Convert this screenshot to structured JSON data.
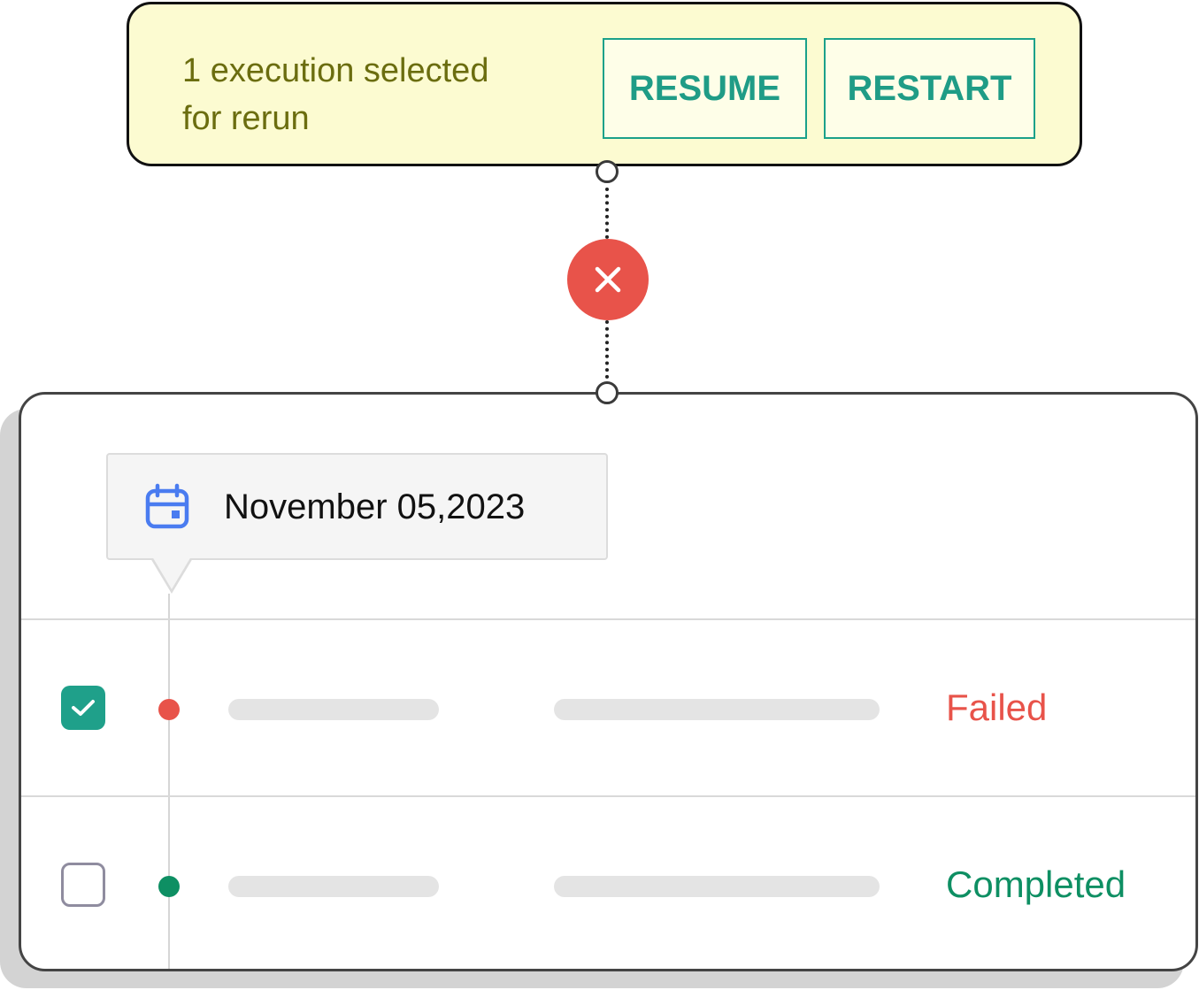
{
  "banner": {
    "selection_text": "1 execution selected\nfor rerun",
    "resume_label": "RESUME",
    "restart_label": "RESTART",
    "background_color": "#fcfbd1",
    "accent_color": "#1f9c86"
  },
  "connector": {
    "status_icon": "close-icon",
    "status_color": "#e8534a"
  },
  "list": {
    "date_icon": "calendar-icon",
    "date": "November 05,2023",
    "rows": [
      {
        "checked": true,
        "status": "Failed",
        "status_color": "#e8534a"
      },
      {
        "checked": false,
        "status": "Completed",
        "status_color": "#0e8f63"
      }
    ]
  }
}
